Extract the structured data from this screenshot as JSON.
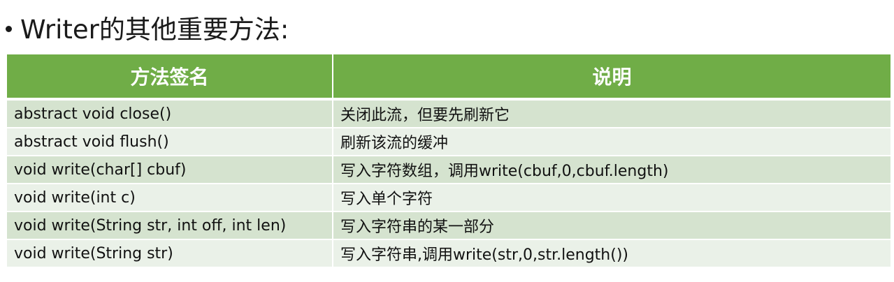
{
  "slide": {
    "title": "Writer的其他重要方法:"
  },
  "table": {
    "headers": [
      "方法签名",
      "说明"
    ],
    "rows": [
      [
        "abstract void close()",
        "关闭此流，但要先刷新它"
      ],
      [
        "abstract void flush()",
        "刷新该流的缓冲"
      ],
      [
        "void write(char[] cbuf)",
        "写入字符数组，调用write(cbuf,0,cbuf.length)"
      ],
      [
        "void write(int c)",
        "写入单个字符"
      ],
      [
        "void write(String str, int off, int len)",
        "写入字符串的某一部分"
      ],
      [
        "void write(String str)",
        "写入字符串,调用write(str,0,str.length())"
      ]
    ]
  },
  "colors": {
    "header_bg": "#70ad47",
    "row_odd_bg": "#d5e3cf",
    "row_even_bg": "#eaf1e8"
  }
}
